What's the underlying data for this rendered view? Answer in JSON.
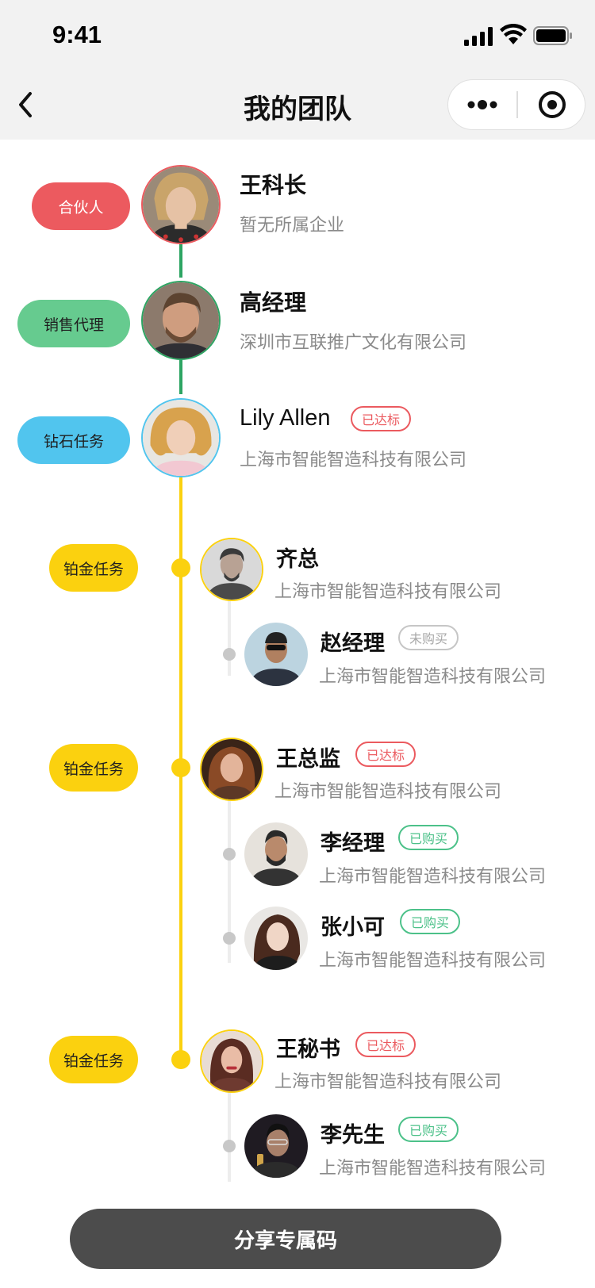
{
  "status_bar": {
    "time": "9:41"
  },
  "nav": {
    "title": "我的团队"
  },
  "colors": {
    "partner": "#EC5A5F",
    "sales": "#66CB8F",
    "diamond": "#51C5EE",
    "platinum": "#FBD10F",
    "line_green": "#2DA563",
    "line_yellow": "#FBD10F"
  },
  "chain": [
    {
      "role": "合伙人",
      "name": "王科长",
      "company": "暂无所属企业",
      "tag": ""
    },
    {
      "role": "销售代理",
      "name": "高经理",
      "company": "深圳市互联推广文化有限公司",
      "tag": ""
    },
    {
      "role": "钻石任务",
      "name": "Lily Allen",
      "company": "上海市智能智造科技有限公司",
      "tag": "已达标"
    }
  ],
  "groups": [
    {
      "role": "铂金任务",
      "name": "齐总",
      "company": "上海市智能智造科技有限公司",
      "tag": "",
      "members": [
        {
          "name": "赵经理",
          "company": "上海市智能智造科技有限公司",
          "tag": "未购买"
        }
      ]
    },
    {
      "role": "铂金任务",
      "name": "王总监",
      "company": "上海市智能智造科技有限公司",
      "tag": "已达标",
      "members": [
        {
          "name": "李经理",
          "company": "上海市智能智造科技有限公司",
          "tag": "已购买"
        },
        {
          "name": "张小可",
          "company": "上海市智能智造科技有限公司",
          "tag": "已购买"
        }
      ]
    },
    {
      "role": "铂金任务",
      "name": "王秘书",
      "company": "上海市智能智造科技有限公司",
      "tag": "已达标",
      "members": [
        {
          "name": "李先生",
          "company": "上海市智能智造科技有限公司",
          "tag": "已购买"
        }
      ]
    }
  ],
  "footer": {
    "share_label": "分享专属码"
  }
}
